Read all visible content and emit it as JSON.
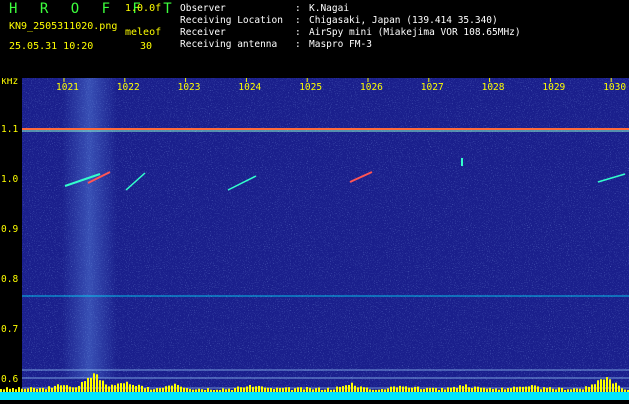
{
  "header": {
    "title": "H R O F F T",
    "version": "1.0.0f",
    "filename": "KN9_2505311020.png",
    "mode": "meleof",
    "datetime": "25.05.31 10:20",
    "value": "30"
  },
  "info": [
    {
      "key": "Observer",
      "sep": ":",
      "value": "K.Nagai"
    },
    {
      "key": "Receiving Location",
      "sep": ":",
      "value": "Chigasaki, Japan (139.414 35.340)"
    },
    {
      "key": "Receiver",
      "sep": ":",
      "value": "AirSpy mini (Miakejima VOR 108.65MHz)"
    },
    {
      "key": "Receiving antenna",
      "sep": ":",
      "value": "Maspro FM-3"
    }
  ],
  "axis": {
    "y_unit": "kHz",
    "x_ticks": [
      "1021",
      "1022",
      "1023",
      "1024",
      "1025",
      "1026",
      "1027",
      "1028",
      "1029",
      "1030"
    ],
    "y_ticks": [
      "1.1",
      "1.0",
      "0.9",
      "0.8",
      "0.7",
      "0.6"
    ]
  },
  "colors": {
    "background": "#1a1f8c",
    "text_label": "#ffff00",
    "title": "#3dff3d",
    "signal_cyan": "#00e5ff"
  }
}
